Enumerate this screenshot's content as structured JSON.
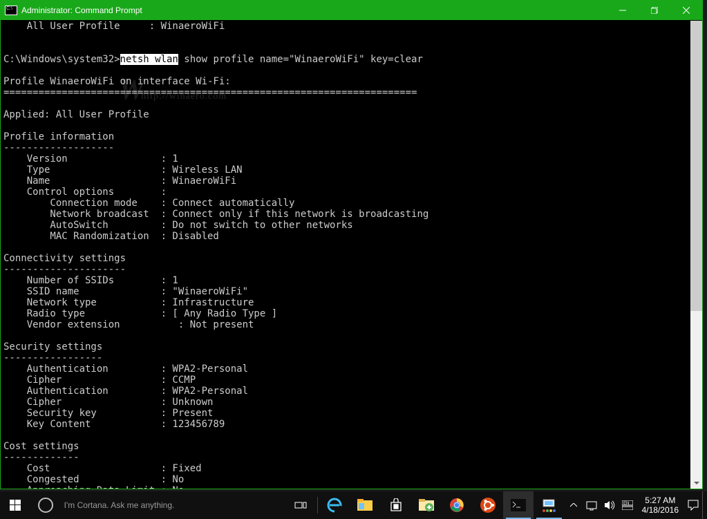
{
  "window": {
    "title": "Administrator: Command Prompt"
  },
  "search": {
    "placeholder": "I'm Cortana. Ask me anything."
  },
  "clock": {
    "time": "5:27 AM",
    "date": "4/18/2016"
  },
  "watermark": "http://winaero.com",
  "pre": {
    "top": "    All User Profile     : WinaeroWiFi\n\n\nC:\\Windows\\system32>",
    "hl": "netsh wlan",
    "rest": " show profile name=\"WinaeroWiFi\" key=clear\n\nProfile WinaeroWiFi on interface Wi-Fi:\n=======================================================================\n\nApplied: All User Profile\n\nProfile information\n-------------------\n    Version                : 1\n    Type                   : Wireless LAN\n    Name                   : WinaeroWiFi\n    Control options        :\n        Connection mode    : Connect automatically\n        Network broadcast  : Connect only if this network is broadcasting\n        AutoSwitch         : Do not switch to other networks\n        MAC Randomization  : Disabled\n\nConnectivity settings\n---------------------\n    Number of SSIDs        : 1\n    SSID name              : \"WinaeroWiFi\"\n    Network type           : Infrastructure\n    Radio type             : [ Any Radio Type ]\n    Vendor extension          : Not present\n\nSecurity settings\n-----------------\n    Authentication         : WPA2-Personal\n    Cipher                 : CCMP\n    Authentication         : WPA2-Personal\n    Cipher                 : Unknown\n    Security key           : Present\n    Key Content            : 123456789\n\nCost settings\n-------------\n    Cost                   : Fixed\n    Congested              : No\n    Approaching Data Limit : No"
  }
}
